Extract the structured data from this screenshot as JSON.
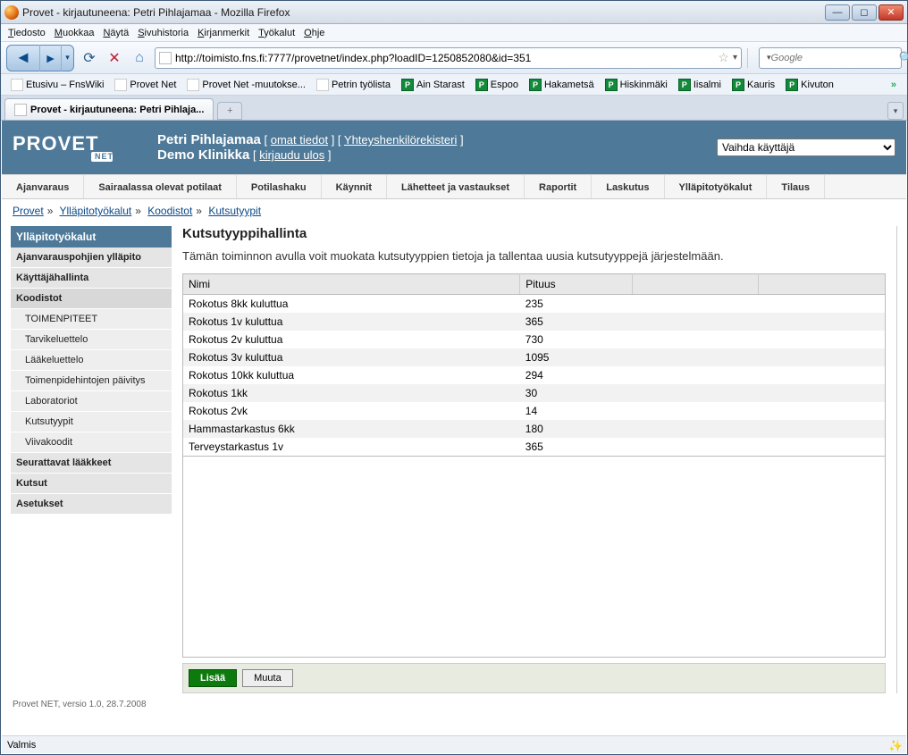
{
  "window": {
    "title": "Provet - kirjautuneena: Petri Pihlajamaa - Mozilla Firefox"
  },
  "menu": [
    "Tiedosto",
    "Muokkaa",
    "Näytä",
    "Sivuhistoria",
    "Kirjanmerkit",
    "Työkalut",
    "Ohje"
  ],
  "nav": {
    "url": "http://toimisto.fns.fi:7777/provetnet/index.php?loadID=1250852080&id=351",
    "search_placeholder": "Google"
  },
  "bookmarks": [
    "Etusivu – FnsWiki",
    "Provet Net",
    "Provet Net -muutokse...",
    "Petrin työlista",
    "Ain Starast",
    "Espoo",
    "Hakametsä",
    "Hiskinmäki",
    "Iisalmi",
    "Kauris",
    "Kivuton"
  ],
  "tab": {
    "label": "Provet - kirjautuneena: Petri Pihlaja..."
  },
  "header": {
    "logo_main": "PROVET",
    "logo_sub": "NET",
    "user_name": "Petri Pihlajamaa",
    "omat_tiedot": "omat tiedot",
    "yhteys": "Yhteyshenkilörekisteri",
    "clinic": "Demo Klinikka",
    "logout": "kirjaudu ulos",
    "switch_user": "Vaihda käyttäjä"
  },
  "mainnav": [
    "Ajanvaraus",
    "Sairaalassa olevat potilaat",
    "Potilashaku",
    "Käynnit",
    "Lähetteet ja vastaukset",
    "Raportit",
    "Laskutus",
    "Ylläpitotyökalut",
    "Tilaus"
  ],
  "crumbs": [
    "Provet",
    "Ylläpitotyökalut",
    "Koodistot",
    "Kutsutyypit"
  ],
  "sidebar": {
    "title": "Ylläpitotyökalut",
    "items": [
      {
        "label": "Ajanvarauspohjien ylläpito",
        "sub": false
      },
      {
        "label": "Käyttäjähallinta",
        "sub": false
      },
      {
        "label": "Koodistot",
        "sub": false,
        "active": true
      },
      {
        "label": "TOIMENPITEET",
        "sub": true
      },
      {
        "label": "Tarvikeluettelo",
        "sub": true
      },
      {
        "label": "Lääkeluettelo",
        "sub": true
      },
      {
        "label": "Toimenpidehintojen päivitys",
        "sub": true
      },
      {
        "label": "Laboratoriot",
        "sub": true
      },
      {
        "label": "Kutsutyypit",
        "sub": true
      },
      {
        "label": "Viivakoodit",
        "sub": true
      },
      {
        "label": "Seurattavat lääkkeet",
        "sub": false
      },
      {
        "label": "Kutsut",
        "sub": false
      },
      {
        "label": "Asetukset",
        "sub": false
      }
    ]
  },
  "main": {
    "heading": "Kutsutyyppihallinta",
    "desc": "Tämän toiminnon avulla voit muokata kutsutyyppien tietoja ja tallentaa uusia kutsutyyppejä järjestelmään.",
    "columns": [
      "Nimi",
      "Pituus",
      "",
      ""
    ],
    "rows": [
      {
        "name": "Rokotus 8kk kuluttua",
        "len": "235"
      },
      {
        "name": "Rokotus 1v kuluttua",
        "len": "365"
      },
      {
        "name": "Rokotus 2v kuluttua",
        "len": "730"
      },
      {
        "name": "Rokotus 3v kuluttua",
        "len": "1095"
      },
      {
        "name": "Rokotus 10kk kuluttua",
        "len": "294"
      },
      {
        "name": "Rokotus 1kk",
        "len": "30"
      },
      {
        "name": "Rokotus 2vk",
        "len": "14"
      },
      {
        "name": "Hammastarkastus 6kk",
        "len": "180"
      },
      {
        "name": "Terveystarkastus 1v",
        "len": "365"
      }
    ],
    "btn_add": "Lisää",
    "btn_edit": "Muuta"
  },
  "footer": "Provet NET, versio 1.0, 28.7.2008",
  "status": "Valmis"
}
